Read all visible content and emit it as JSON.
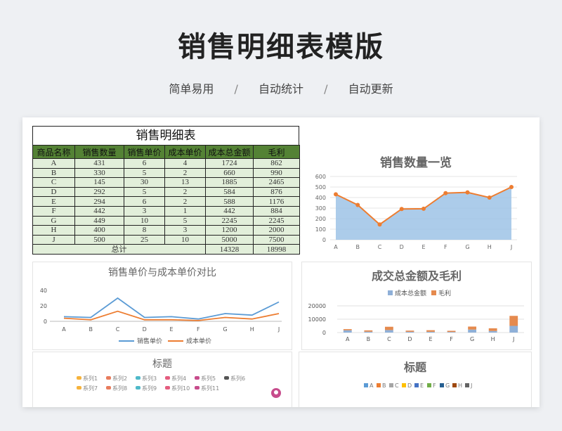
{
  "hero": {
    "title": "销售明细表模版",
    "subtitles": [
      "简单易用",
      "自动统计",
      "自动更新"
    ],
    "separator": "/"
  },
  "table": {
    "title": "销售明细表",
    "headers": [
      "商品名称",
      "销售数量",
      "销售单价",
      "成本单价",
      "成本总金额",
      "毛利"
    ],
    "rows": [
      [
        "A",
        "431",
        "6",
        "4",
        "1724",
        "862"
      ],
      [
        "B",
        "330",
        "5",
        "2",
        "660",
        "990"
      ],
      [
        "C",
        "145",
        "30",
        "13",
        "1885",
        "2465"
      ],
      [
        "D",
        "292",
        "5",
        "2",
        "584",
        "876"
      ],
      [
        "E",
        "294",
        "6",
        "2",
        "588",
        "1176"
      ],
      [
        "F",
        "442",
        "3",
        "1",
        "442",
        "884"
      ],
      [
        "G",
        "449",
        "10",
        "5",
        "2245",
        "2245"
      ],
      [
        "H",
        "400",
        "8",
        "3",
        "1200",
        "2000"
      ],
      [
        "J",
        "500",
        "25",
        "10",
        "5000",
        "7500"
      ]
    ],
    "total_label": "总计",
    "total_cost": "14328",
    "total_profit": "18998",
    "header_color": "#548235",
    "cell_color": "#e2efda"
  },
  "chart_data": [
    {
      "type": "area",
      "title": "销售数量一览",
      "categories": [
        "A",
        "B",
        "C",
        "D",
        "E",
        "F",
        "G",
        "H",
        "J"
      ],
      "values": [
        431,
        330,
        145,
        292,
        294,
        442,
        449,
        400,
        500
      ],
      "ylim": [
        0,
        600
      ],
      "yticks": [
        0,
        100,
        200,
        300,
        400,
        500,
        600
      ],
      "fill_color": "#9dc3e6",
      "line_color": "#ed7d31"
    },
    {
      "type": "line",
      "title": "销售单价与成本单价对比",
      "categories": [
        "A",
        "B",
        "C",
        "D",
        "E",
        "F",
        "G",
        "H",
        "J"
      ],
      "series": [
        {
          "name": "销售单价",
          "values": [
            6,
            5,
            30,
            5,
            6,
            3,
            10,
            8,
            25
          ],
          "color": "#5b9bd5"
        },
        {
          "name": "成本单价",
          "values": [
            4,
            2,
            13,
            2,
            2,
            1,
            5,
            3,
            10
          ],
          "color": "#ed7d31"
        }
      ],
      "ylim": [
        0,
        40
      ],
      "yticks": [
        0,
        20,
        40
      ]
    },
    {
      "type": "bar",
      "title": "成交总金额及毛利",
      "categories": [
        "A",
        "B",
        "C",
        "D",
        "E",
        "F",
        "G",
        "H",
        "J"
      ],
      "series": [
        {
          "name": "成本总金额",
          "values": [
            1724,
            660,
            1885,
            584,
            588,
            442,
            2245,
            1200,
            5000
          ],
          "color": "#8fb0d8"
        },
        {
          "name": "毛利",
          "values": [
            862,
            990,
            2465,
            876,
            1176,
            884,
            2245,
            2000,
            7500
          ],
          "color": "#e58a4e"
        }
      ],
      "ylim": [
        0,
        20000
      ],
      "yticks": [
        0,
        10000,
        20000
      ]
    },
    {
      "type": "pie",
      "title": "标题",
      "legend": [
        "系列1",
        "系列2",
        "系列3",
        "系列4",
        "系列5",
        "系列6",
        "系列7",
        "系列8",
        "系列9",
        "系列10",
        "系列11"
      ],
      "legend_colors": [
        "#f6b33c",
        "#e87c5d",
        "#4fb9c9",
        "#e45d7f",
        "#c74c8c",
        "#555555",
        "#f6b33c",
        "#e87c5d",
        "#4fb9c9",
        "#e45d7f",
        "#c74c8c"
      ]
    },
    {
      "type": "pie",
      "title": "标题",
      "legend": [
        "A",
        "B",
        "C",
        "D",
        "E",
        "F",
        "G",
        "H",
        "J"
      ],
      "legend_colors": [
        "#5b9bd5",
        "#ed7d31",
        "#a5a5a5",
        "#ffc000",
        "#4472c4",
        "#70ad47",
        "#255e91",
        "#9e480e",
        "#636363"
      ]
    }
  ]
}
